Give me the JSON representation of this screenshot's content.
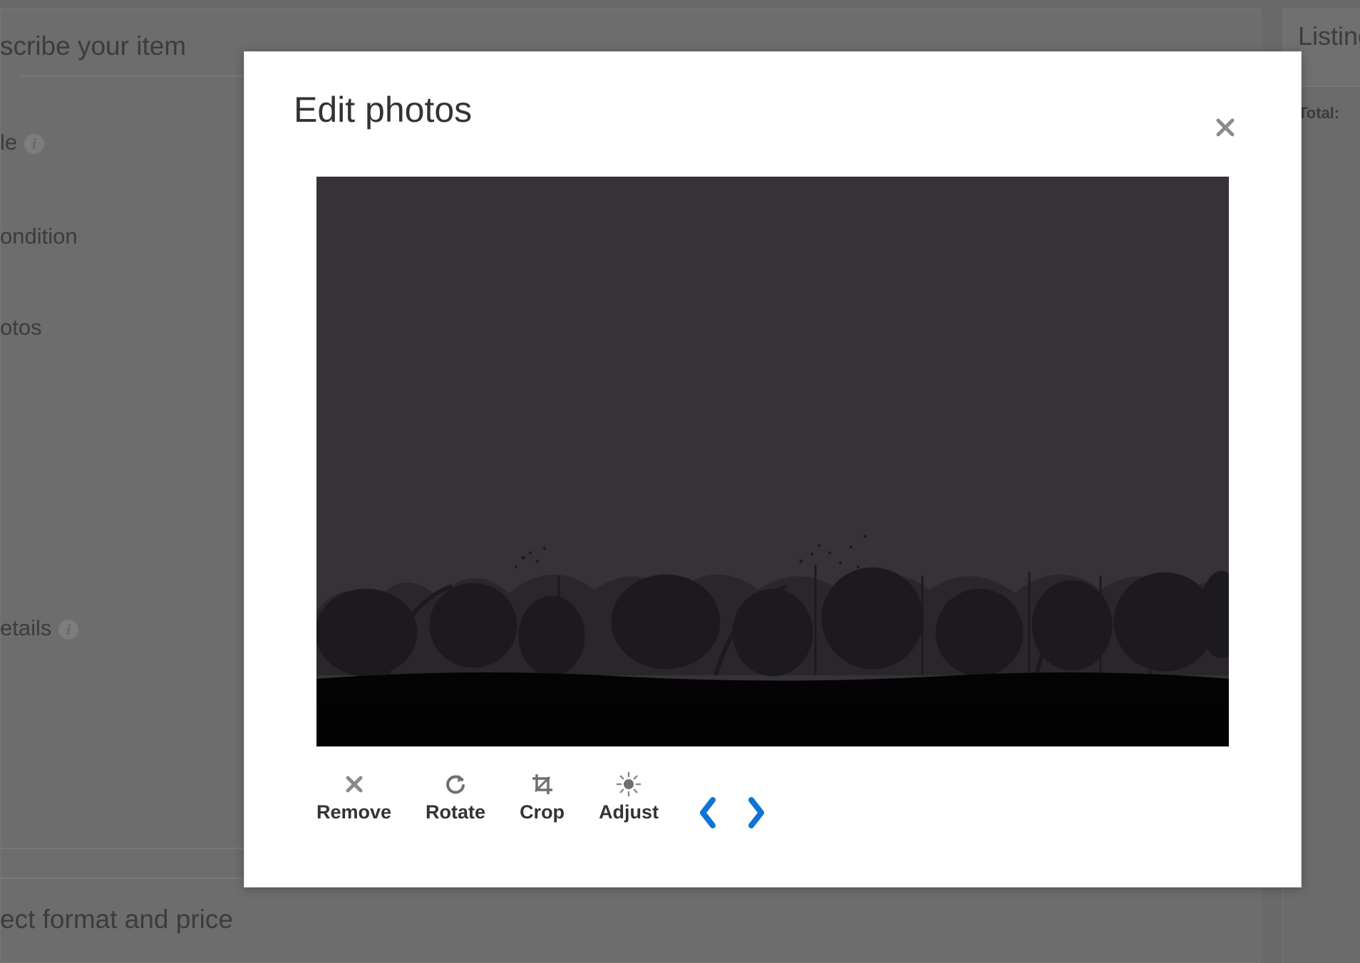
{
  "background": {
    "section1_heading": "scribe your item",
    "field_title": "le",
    "field_condition": "ondition",
    "field_photos": "otos",
    "field_details": "etails",
    "section2_heading": "ect format and price",
    "side_heading": "Listing",
    "side_total": "Total:"
  },
  "modal": {
    "title": "Edit photos",
    "tools": {
      "remove": "Remove",
      "rotate": "Rotate",
      "crop": "Crop",
      "adjust": "Adjust"
    }
  },
  "colors": {
    "accent": "#0f74d3",
    "overlay": "#6a6a6a",
    "photo_sky": "#363238",
    "icon_gray": "#8a8a8a"
  },
  "icons": [
    "close-icon",
    "remove-icon",
    "rotate-icon",
    "crop-icon",
    "adjust-icon",
    "chevron-left-icon",
    "chevron-right-icon"
  ]
}
